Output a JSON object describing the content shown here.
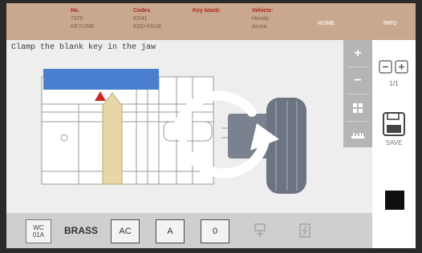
{
  "header": {
    "columns": [
      {
        "label": "No.",
        "values": [
          "7375",
          "KEYLINE"
        ]
      },
      {
        "label": "Codes",
        "values": [
          "KD41",
          "KDD-KN18"
        ]
      },
      {
        "label": "Key blank:",
        "values": []
      },
      {
        "label": "Vehicle:",
        "values": [
          "Honda",
          "Acura"
        ]
      }
    ],
    "home_label": "HOME",
    "info_label": "INFO"
  },
  "instruction": "Clamp the blank key in the jaw",
  "zoom_buttons": [
    {
      "symbol": "+",
      "icon": "zoom-in-icon"
    },
    {
      "symbol": "−",
      "icon": "zoom-out-icon"
    },
    {
      "symbol": "",
      "icon": "fit-screen-icon"
    },
    {
      "symbol": "",
      "icon": "measure-icon"
    }
  ],
  "right_panel": {
    "page_indicator": "1/1",
    "save_label": "SAVE"
  },
  "toolbar": {
    "wc_line1": "WC",
    "wc_line2": "01A",
    "material": "BRASS",
    "ac_label": "AC",
    "a_label": "A",
    "zero_label": "0"
  },
  "colors": {
    "header_bg": "#c9a88f",
    "header_label": "#b0271e",
    "blade": "#4a7fcf",
    "stop_marker": "#d02a20",
    "key_blank": "#e6d6a8",
    "zoom_panel": "#b5b5b5",
    "toolbar_bg": "#cfcfcf"
  }
}
